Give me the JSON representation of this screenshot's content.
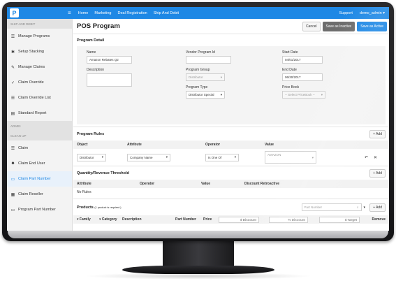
{
  "topbar": {
    "logo": "P",
    "menu_icon": "hamburger-icon",
    "nav": [
      "Home",
      "Marketing",
      "Deal Registration",
      "Ship And Debit"
    ],
    "support": "Support",
    "user": "demo_admin"
  },
  "sidebar": {
    "section1": "SHIP AND DEBIT",
    "section2": "ADMIN",
    "section3": "CLEAN UP",
    "items_top": [
      {
        "label": "Manage Programs",
        "icon": "list-icon"
      },
      {
        "label": "Setup Stacking",
        "icon": "gear-icon"
      },
      {
        "label": "Manage Claims",
        "icon": "pencil-icon"
      },
      {
        "label": "Claim Override",
        "icon": "check-icon"
      },
      {
        "label": "Claim Override List",
        "icon": "list-icon"
      },
      {
        "label": "Standard Report",
        "icon": "report-icon"
      }
    ],
    "items_bottom": [
      {
        "label": "Claim",
        "icon": "list-icon"
      },
      {
        "label": "Claim End User",
        "icon": "users-icon"
      },
      {
        "label": "Claim Part Number",
        "icon": "card-icon"
      },
      {
        "label": "Claim Reseller",
        "icon": "store-icon"
      },
      {
        "label": "Program Part Number",
        "icon": "card-icon"
      }
    ]
  },
  "header": {
    "title": "POS Program",
    "cancel": "Cancel",
    "save_inactive": "Save as Inactive",
    "save_active": "Save as Active"
  },
  "detail": {
    "section_title": "Program Detail",
    "name_label": "Name",
    "name_value": "Amazon Rebates Q2",
    "description_label": "Description",
    "vendor_label": "Vendor Program Id",
    "group_label": "Program Group",
    "group_value": "Distributor",
    "type_label": "Program Type",
    "type_value": "Distributor Special",
    "start_label": "Start Date",
    "start_value": "04/01/2017",
    "end_label": "End Date",
    "end_value": "06/30/2017",
    "pricebook_label": "Price Book",
    "pricebook_value": "-- Select PriceBook --"
  },
  "rules": {
    "title": "Program Rules",
    "add": "+ Add",
    "headers": [
      "Object",
      "Attribute",
      "Operator",
      "Value"
    ],
    "row": {
      "object": "Distributor",
      "attribute": "Company Name",
      "operator": "Is One Of",
      "value": "AMAZON"
    }
  },
  "threshold": {
    "title": "Quantity/Revenue Threshold",
    "add": "+ Add",
    "headers": [
      "Attribute",
      "Operator",
      "Value",
      "Discount Retroactive"
    ],
    "empty": "No Rules"
  },
  "products": {
    "title": "Products",
    "note": "(1 product is required.)",
    "search_placeholder": "Part Number",
    "add": "+ Add",
    "columns": [
      "Family",
      "Category",
      "Description",
      "Part Number",
      "Price"
    ],
    "discount_amount": "$ Discount",
    "discount_percent": "% Discount",
    "target": "$ Target",
    "remove": "Remove"
  }
}
